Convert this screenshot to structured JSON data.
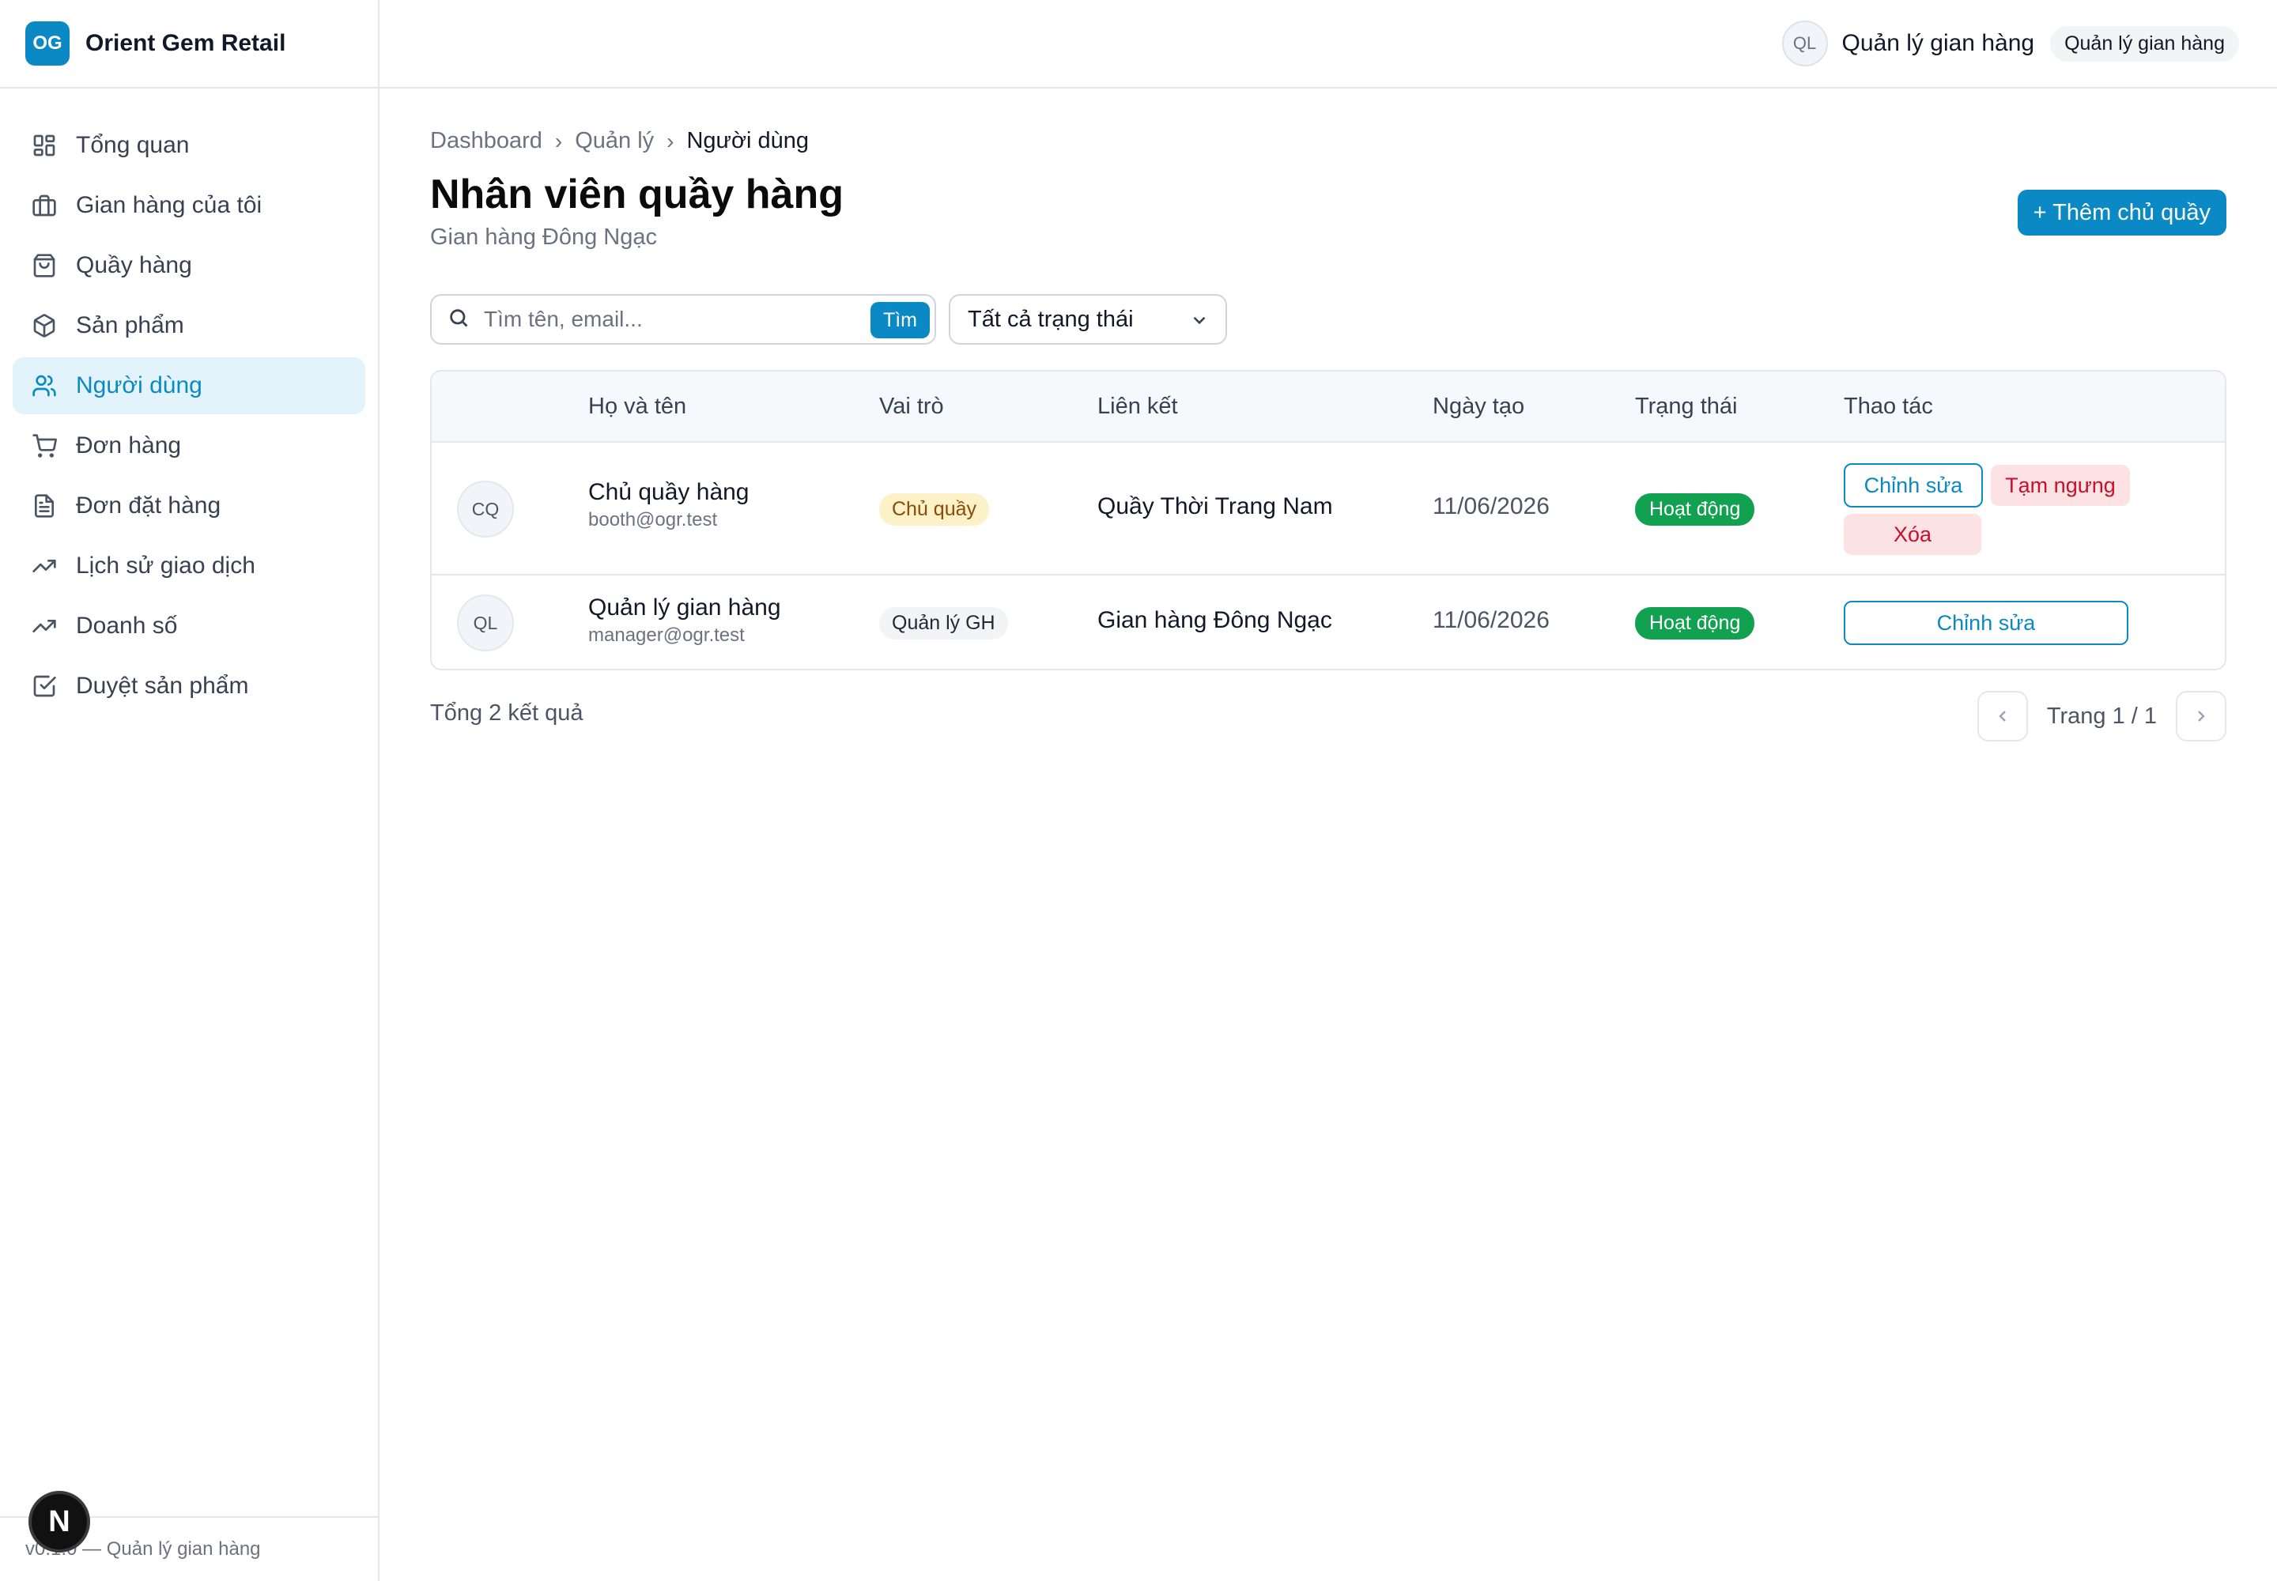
{
  "brand": {
    "logo": "OG",
    "name": "Orient Gem Retail"
  },
  "sidebar": {
    "items": [
      {
        "label": "Tổng quan",
        "icon": "grid-icon"
      },
      {
        "label": "Gian hàng của tôi",
        "icon": "briefcase-icon"
      },
      {
        "label": "Quầy hàng",
        "icon": "shopping-bag-icon"
      },
      {
        "label": "Sản phẩm",
        "icon": "package-icon"
      },
      {
        "label": "Người dùng",
        "icon": "users-icon",
        "active": true
      },
      {
        "label": "Đơn hàng",
        "icon": "cart-icon"
      },
      {
        "label": "Đơn đặt hàng",
        "icon": "file-text-icon"
      },
      {
        "label": "Lịch sử giao dịch",
        "icon": "trending-up-icon"
      },
      {
        "label": "Doanh số",
        "icon": "trending-up-icon"
      },
      {
        "label": "Duyệt sản phẩm",
        "icon": "check-square-icon"
      }
    ],
    "footer": "v0.1.0 — Quản lý gian hàng"
  },
  "topbar": {
    "avatar": "QL",
    "user_name": "Quản lý gian hàng",
    "role": "Quản lý gian hàng"
  },
  "breadcrumb": [
    "Dashboard",
    "Quản lý",
    "Người dùng"
  ],
  "page": {
    "title": "Nhân viên quầy hàng",
    "subtitle": "Gian hàng Đông Ngạc",
    "add_button": "+ Thêm chủ quầy"
  },
  "filters": {
    "search_placeholder": "Tìm tên, email...",
    "search_button": "Tìm",
    "status_select": "Tất cả trạng thái"
  },
  "table": {
    "headers": [
      "Họ và tên",
      "Vai trò",
      "Liên kết",
      "Ngày tạo",
      "Trạng thái",
      "Thao tác"
    ],
    "rows": [
      {
        "avatar": "CQ",
        "name": "Chủ quầy hàng",
        "email": "booth@ogr.test",
        "role": "Chủ quầy",
        "link": "Quầy Thời Trang Nam",
        "date": "11/06/2026",
        "status": "Hoạt động",
        "actions": [
          "Chỉnh sửa",
          "Tạm ngưng",
          "Xóa"
        ]
      },
      {
        "avatar": "QL",
        "name": "Quản lý gian hàng",
        "email": "manager@ogr.test",
        "role": "Quản lý GH",
        "link": "Gian hàng Đông Ngạc",
        "date": "11/06/2026",
        "status": "Hoạt động",
        "actions": [
          "Chỉnh sửa"
        ]
      }
    ]
  },
  "footer": {
    "total": "Tổng 2 kết quả",
    "page": "Trang 1 / 1"
  },
  "colors": {
    "primary": "#0a89c4",
    "success": "#12a150",
    "danger": "#c8102e"
  }
}
